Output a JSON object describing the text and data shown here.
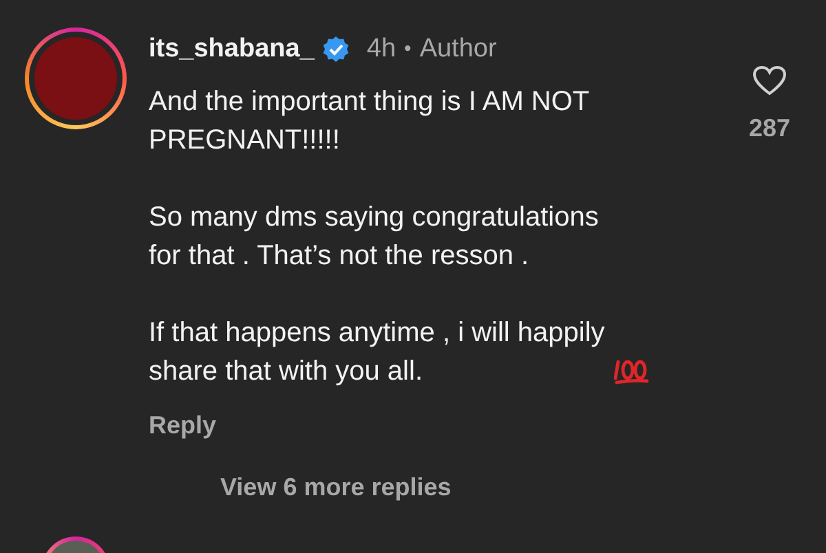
{
  "comment": {
    "username": "its_shabana_",
    "verified": true,
    "time": "4h",
    "separator": "•",
    "role": "Author",
    "paragraphs": [
      "And the important thing is I AM NOT PREGNANT!!!!!",
      "So many dms saying congratulations for that . That’s not the resson .",
      "If that happens anytime , i will happily share that with you all."
    ],
    "liked": false,
    "like_count": "287",
    "reply": "Reply",
    "view_replies": "View 6 more replies"
  }
}
